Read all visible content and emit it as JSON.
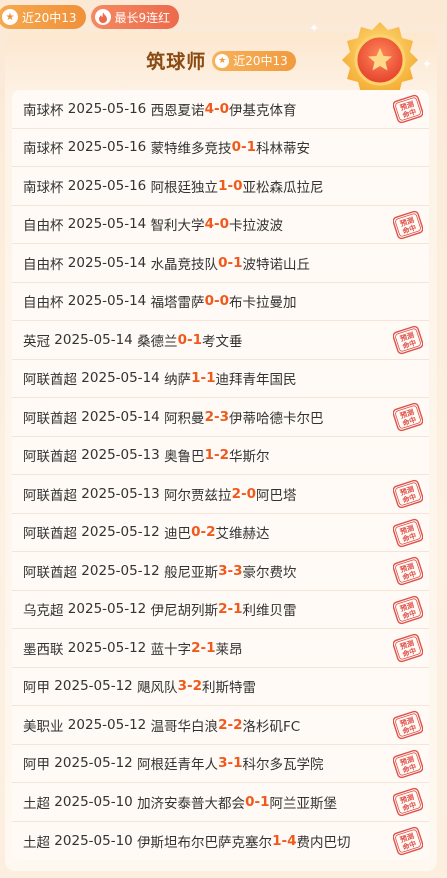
{
  "top_badges": [
    {
      "icon": "star-icon",
      "label": "近20中13"
    },
    {
      "icon": "flame-icon",
      "label": "最长9连红"
    }
  ],
  "header": {
    "title": "筑球师",
    "badge_label": "近20中13",
    "badge_icon": "star-icon",
    "medal_icon": "medal-icon"
  },
  "stamp_text": [
    "预测",
    "命中"
  ],
  "colors": {
    "accent": "#ef5a1c",
    "stamp": "#e0504a",
    "title": "#8a4a12"
  },
  "matches": [
    {
      "league": "南球杯",
      "date": "2025-05-16",
      "home": "西恩夏诺",
      "home_score": "4",
      "sep": " - ",
      "away_score": "0",
      "away": "伊基克体育",
      "hit": true
    },
    {
      "league": "南球杯",
      "date": "2025-05-16",
      "home": "蒙特维多竞技",
      "home_score": "0",
      "sep": " - ",
      "away_score": "1",
      "away": "科林蒂安",
      "hit": false
    },
    {
      "league": "南球杯",
      "date": "2025-05-16",
      "home": "阿根廷独立",
      "home_score": "1",
      "sep": " - ",
      "away_score": "0",
      "away": "亚松森瓜拉尼",
      "hit": false
    },
    {
      "league": "自由杯",
      "date": "2025-05-14",
      "home": "智利大学",
      "home_score": "4",
      "sep": " - ",
      "away_score": "0",
      "away": "卡拉波波",
      "hit": true
    },
    {
      "league": "自由杯",
      "date": "2025-05-14",
      "home": "水晶竞技队",
      "home_score": "0",
      "sep": " - ",
      "away_score": "1",
      "away": "波特诺山丘",
      "hit": false
    },
    {
      "league": "自由杯",
      "date": "2025-05-14",
      "home": "福塔雷萨",
      "home_score": "0",
      "sep": " - ",
      "away_score": "0",
      "away": "布卡拉曼加",
      "hit": false
    },
    {
      "league": "英冠",
      "date": "2025-05-14",
      "home": "桑德兰",
      "home_score": "0",
      "sep": " - ",
      "away_score": "1",
      "away": "考文垂",
      "hit": true
    },
    {
      "league": "阿联酋超",
      "date": "2025-05-14",
      "home": "纳萨",
      "home_score": "1",
      "sep": " - ",
      "away_score": "1",
      "away": "迪拜青年国民",
      "hit": false
    },
    {
      "league": "阿联酋超",
      "date": "2025-05-14",
      "home": "阿积曼",
      "home_score": "2",
      "sep": " - ",
      "away_score": "3",
      "away": "伊蒂哈德卡尔巴",
      "hit": true
    },
    {
      "league": "阿联酋超",
      "date": "2025-05-13",
      "home": "奥鲁巴",
      "home_score": "1",
      "sep": " - ",
      "away_score": "2",
      "away": "华斯尔",
      "hit": false
    },
    {
      "league": "阿联酋超",
      "date": "2025-05-13",
      "home": "阿尔贾兹拉",
      "home_score": "2",
      "sep": " - ",
      "away_score": "0",
      "away": "阿巴塔",
      "hit": true
    },
    {
      "league": "阿联酋超",
      "date": "2025-05-12",
      "home": "迪巴",
      "home_score": "0",
      "sep": " - ",
      "away_score": "2",
      "away": "艾维赫达",
      "hit": true
    },
    {
      "league": "阿联酋超",
      "date": "2025-05-12",
      "home": "般尼亚斯",
      "home_score": "3",
      "sep": " - ",
      "away_score": "3",
      "away": "豪尔费坎",
      "hit": true
    },
    {
      "league": "乌克超",
      "date": "2025-05-12",
      "home": "伊尼胡列斯",
      "home_score": "2",
      "sep": " - ",
      "away_score": "1",
      "away": "利维贝雷",
      "hit": true
    },
    {
      "league": "墨西联",
      "date": "2025-05-12",
      "home": "蓝十字",
      "home_score": "2",
      "sep": " - ",
      "away_score": "1",
      "away": "莱昂",
      "hit": true
    },
    {
      "league": "阿甲",
      "date": "2025-05-12",
      "home": "飓风队",
      "home_score": "3",
      "sep": " - ",
      "away_score": "2",
      "away": "利斯特雷",
      "hit": false
    },
    {
      "league": "美职业",
      "date": "2025-05-12",
      "home": "温哥华白浪",
      "home_score": "2",
      "sep": " - ",
      "away_score": "2",
      "away": "洛杉矶FC",
      "hit": true
    },
    {
      "league": "阿甲",
      "date": "2025-05-12",
      "home": "阿根廷青年人",
      "home_score": "3",
      "sep": " - ",
      "away_score": "1",
      "away": "科尔多瓦学院",
      "hit": true
    },
    {
      "league": "土超",
      "date": "2025-05-10",
      "home": "加济安泰普大都会",
      "home_score": "0",
      "sep": " - ",
      "away_score": "1",
      "away": "阿兰亚斯堡",
      "hit": true
    },
    {
      "league": "土超",
      "date": "2025-05-10",
      "home": "伊斯坦布尔巴萨克塞尔",
      "home_score": "1",
      "sep": " - ",
      "away_score": "4",
      "away": "费内巴切",
      "hit": true
    }
  ]
}
